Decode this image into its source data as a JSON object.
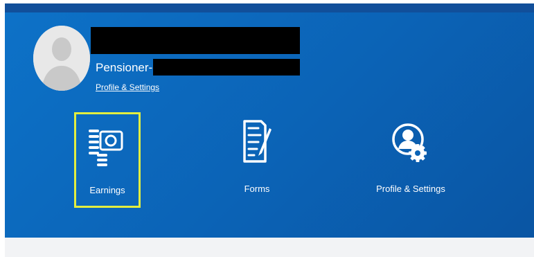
{
  "user": {
    "role_label": "Pensioner-",
    "profile_link": "Profile & Settings"
  },
  "tiles": [
    {
      "label": "Earnings",
      "icon": "earnings-icon",
      "selected": true
    },
    {
      "label": "Forms",
      "icon": "forms-icon",
      "selected": false
    },
    {
      "label": "Profile & Settings",
      "icon": "profile-settings-icon",
      "selected": false
    }
  ],
  "colors": {
    "panel": "#0b63b6",
    "topbar": "#114f9a",
    "highlight": "#e3ee3f",
    "footer": "#f2f3f5"
  }
}
